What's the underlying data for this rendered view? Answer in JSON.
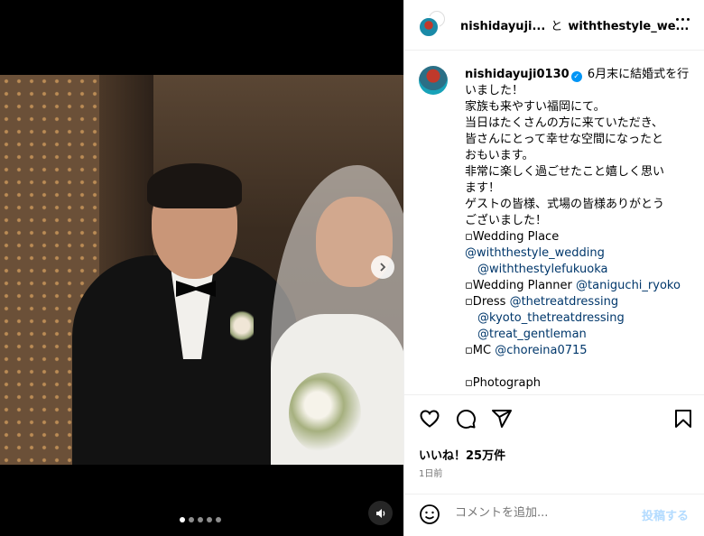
{
  "header": {
    "username": "nishidayuji...",
    "connector": "と",
    "collaborator": "withthestyle_we..."
  },
  "caption": {
    "username": "nishidayuji0130",
    "lines": [
      "6月末に結婚式を行",
      "いました！",
      "家族も来やすい福岡にて。",
      "当日はたくさんの方に来ていただき、",
      "皆さんにとって幸せな空間になったと",
      "おもいます。",
      "非常に楽しく過ごせたこと嬉しく思い",
      "ます！",
      "ゲストの皆様、式場の皆様ありがとう",
      "ございました！"
    ],
    "wedding_place_label": "▫︎Wedding Place",
    "wedding_place_link1": "@withthestyle_wedding",
    "wedding_place_link2": "@withthestylefukuoka",
    "planner_label": "▫︎Wedding Planner ",
    "planner_link": "@taniguchi_ryoko",
    "dress_label": "▫︎Dress ",
    "dress_link1": "@thetreatdressing",
    "dress_link2": "@kyoto_thetreatdressing",
    "dress_link3": "@treat_gentleman",
    "mc_label": "▫︎MC ",
    "mc_link": "@choreina0715",
    "photograph_label": "▫︎Photograph"
  },
  "likes": "いいね！25万件",
  "timestamp": "1日前",
  "comment": {
    "placeholder": "コメントを追加...",
    "post_label": "投稿する"
  },
  "carousel": {
    "total_slides": 5,
    "active_slide": 1
  }
}
